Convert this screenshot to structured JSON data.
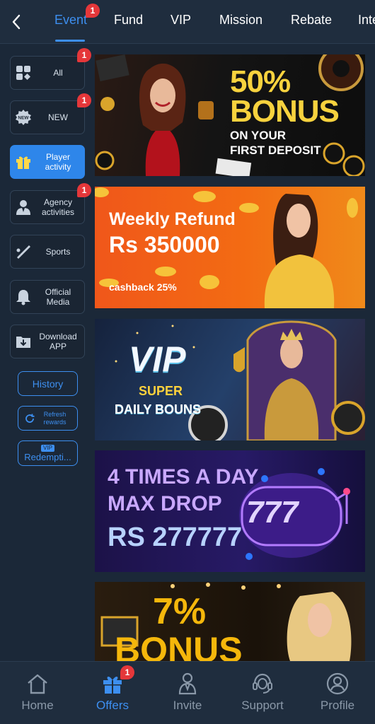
{
  "tabs": [
    {
      "label": "Event",
      "active": true,
      "badge": "1"
    },
    {
      "label": "Fund"
    },
    {
      "label": "VIP"
    },
    {
      "label": "Mission"
    },
    {
      "label": "Rebate"
    },
    {
      "label": "Inte"
    }
  ],
  "sidebar": {
    "items": [
      {
        "label": "All",
        "icon": "grid-cards-icon",
        "badge": "1"
      },
      {
        "label": "NEW",
        "icon": "new-badge-icon",
        "badge": "1"
      },
      {
        "label": "Player activity",
        "icon": "gift-icon",
        "active": true
      },
      {
        "label": "Agency activities",
        "icon": "agent-icon",
        "badge": "1"
      },
      {
        "label": "Sports",
        "icon": "sports-icon"
      },
      {
        "label": "Official Media",
        "icon": "bell-icon"
      },
      {
        "label": "Download APP",
        "icon": "download-icon"
      }
    ],
    "history_label": "History",
    "refresh_label": "Refresh rewards",
    "redemption_label": "Redempti...",
    "redemption_icon_text": "VIP"
  },
  "banners": [
    {
      "line1": "50%",
      "line2": "BONUS",
      "line3": "ON YOUR",
      "line4": "FIRST DEPOSIT",
      "bg": "#141414",
      "accent": "#f7d23e"
    },
    {
      "line1": "Weekly Refund",
      "line2": "Rs 350000",
      "line3": "cashback 25%",
      "bg": "#f26a12",
      "accent": "#ffffff"
    },
    {
      "line1": "VIP",
      "line2": "SUPER",
      "line3": "DAILY BOUNS",
      "bg": "#1c2f4d",
      "accent": "#ffd23c"
    },
    {
      "line1": "4 TIMES A DAY",
      "line2": "MAX DROP",
      "line3": "RS 277777",
      "line4": "777",
      "bg": "#1e1450",
      "accent": "#c9a8ff"
    },
    {
      "line1": "7%",
      "line2": "BONUS",
      "bg": "#1a1209",
      "accent": "#f5b70b"
    }
  ],
  "bottom_nav": [
    {
      "label": "Home",
      "icon": "home-icon"
    },
    {
      "label": "Offers",
      "icon": "gift-icon",
      "active": true,
      "badge": "1"
    },
    {
      "label": "Invite",
      "icon": "invite-icon"
    },
    {
      "label": "Support",
      "icon": "support-headset-icon"
    },
    {
      "label": "Profile",
      "icon": "profile-icon"
    }
  ],
  "colors": {
    "accent": "#3d8ff0",
    "badge": "#e5373a",
    "background": "#1b2838"
  }
}
